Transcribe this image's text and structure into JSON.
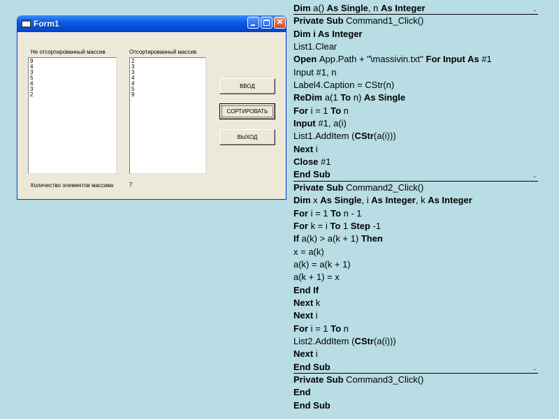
{
  "form": {
    "title": "Form1",
    "label_unsorted": "Не отсортированный массив",
    "label_sorted": "Отсортированный массив",
    "list_unsorted": [
      "9",
      "4",
      "3",
      "5",
      "4",
      "3",
      "2"
    ],
    "list_sorted": [
      "2",
      "3",
      "3",
      "4",
      "4",
      "5",
      "9"
    ],
    "btn_input": "ВВОД",
    "btn_sort": "СОРТИРОВАТЬ",
    "btn_exit": "ВЫХОД",
    "count_label": "Количество элементов массива",
    "count_value": "7"
  },
  "code_lines": [
    [
      {
        "t": "Dim ",
        "b": true
      },
      {
        "t": "a() ",
        "b": false
      },
      {
        "t": "As Single",
        "b": true
      },
      {
        "t": ", n ",
        "b": false
      },
      {
        "t": "As Integer",
        "b": true
      }
    ],
    [
      {
        "t": "Private Sub ",
        "b": true
      },
      {
        "t": "Command1_Click()",
        "b": false
      }
    ],
    [
      {
        "t": "Dim i As Integer",
        "b": true
      }
    ],
    [
      {
        "t": "List1.Clear",
        "b": false
      }
    ],
    [
      {
        "t": "Open ",
        "b": true
      },
      {
        "t": "App.Path + \"\\massivin.txt\" ",
        "b": false
      },
      {
        "t": "For Input As ",
        "b": true
      },
      {
        "t": "#1",
        "b": false
      }
    ],
    [
      {
        "t": "Input #1, n",
        "b": false
      }
    ],
    [
      {
        "t": "Label4.Caption = CStr(n)",
        "b": false
      }
    ],
    [
      {
        "t": "ReDim ",
        "b": true
      },
      {
        "t": "a(1 ",
        "b": false
      },
      {
        "t": "To ",
        "b": true
      },
      {
        "t": "n) ",
        "b": false
      },
      {
        "t": "As Single",
        "b": true
      }
    ],
    [
      {
        "t": "For ",
        "b": true
      },
      {
        "t": "i = 1 ",
        "b": false
      },
      {
        "t": "To ",
        "b": true
      },
      {
        "t": "n",
        "b": false
      }
    ],
    [
      {
        "t": "Input ",
        "b": true
      },
      {
        "t": "#1, a(i)",
        "b": false
      }
    ],
    [
      {
        "t": "List1.AddItem (",
        "b": false
      },
      {
        "t": "CStr",
        "b": true
      },
      {
        "t": "(a(i)))",
        "b": false
      }
    ],
    [
      {
        "t": "Next ",
        "b": true
      },
      {
        "t": "i",
        "b": false
      }
    ],
    [
      {
        "t": "Close ",
        "b": true
      },
      {
        "t": "#1",
        "b": false
      }
    ],
    [
      {
        "t": "End Sub",
        "b": true
      }
    ],
    [
      {
        "t": "Private Sub ",
        "b": true
      },
      {
        "t": "Command2_Click()",
        "b": false
      }
    ],
    [
      {
        "t": "Dim ",
        "b": true
      },
      {
        "t": "x ",
        "b": false
      },
      {
        "t": "As Single",
        "b": true
      },
      {
        "t": ", i ",
        "b": false
      },
      {
        "t": "As Integer",
        "b": true
      },
      {
        "t": ", k ",
        "b": false
      },
      {
        "t": "As Integer",
        "b": true
      }
    ],
    [
      {
        "t": "For ",
        "b": true
      },
      {
        "t": "i = 1 ",
        "b": false
      },
      {
        "t": "To ",
        "b": true
      },
      {
        "t": "n - 1",
        "b": false
      }
    ],
    [
      {
        "t": "For ",
        "b": true
      },
      {
        "t": "k = i ",
        "b": false
      },
      {
        "t": "To ",
        "b": true
      },
      {
        "t": "1 ",
        "b": false
      },
      {
        "t": "Step ",
        "b": true
      },
      {
        "t": "-1",
        "b": false
      }
    ],
    [
      {
        "t": "If ",
        "b": true
      },
      {
        "t": "a(k) > a(k + 1) ",
        "b": false
      },
      {
        "t": "Then",
        "b": true
      }
    ],
    [
      {
        "t": "x = a(k)",
        "b": false
      }
    ],
    [
      {
        "t": "a(k) = a(k + 1)",
        "b": false
      }
    ],
    [
      {
        "t": "a(k + 1) = x",
        "b": false
      }
    ],
    [
      {
        "t": "End If",
        "b": true
      }
    ],
    [
      {
        "t": "Next ",
        "b": true
      },
      {
        "t": "k",
        "b": false
      }
    ],
    [
      {
        "t": "Next ",
        "b": true
      },
      {
        "t": "i",
        "b": false
      }
    ],
    [
      {
        "t": "For ",
        "b": true
      },
      {
        "t": "i = 1 ",
        "b": false
      },
      {
        "t": "To ",
        "b": true
      },
      {
        "t": "n",
        "b": false
      }
    ],
    [
      {
        "t": "List2.AddItem (",
        "b": false
      },
      {
        "t": "CStr",
        "b": true
      },
      {
        "t": "(a(i)))",
        "b": false
      }
    ],
    [
      {
        "t": "Next ",
        "b": true
      },
      {
        "t": "i",
        "b": false
      }
    ],
    [
      {
        "t": "End Sub",
        "b": true
      }
    ],
    [
      {
        "t": "Private Sub ",
        "b": true
      },
      {
        "t": "Command3_Click()",
        "b": false
      }
    ],
    [
      {
        "t": "End",
        "b": true
      }
    ],
    [
      {
        "t": "End Sub",
        "b": true
      }
    ]
  ],
  "underlined_lines": [
    0,
    13,
    28
  ]
}
